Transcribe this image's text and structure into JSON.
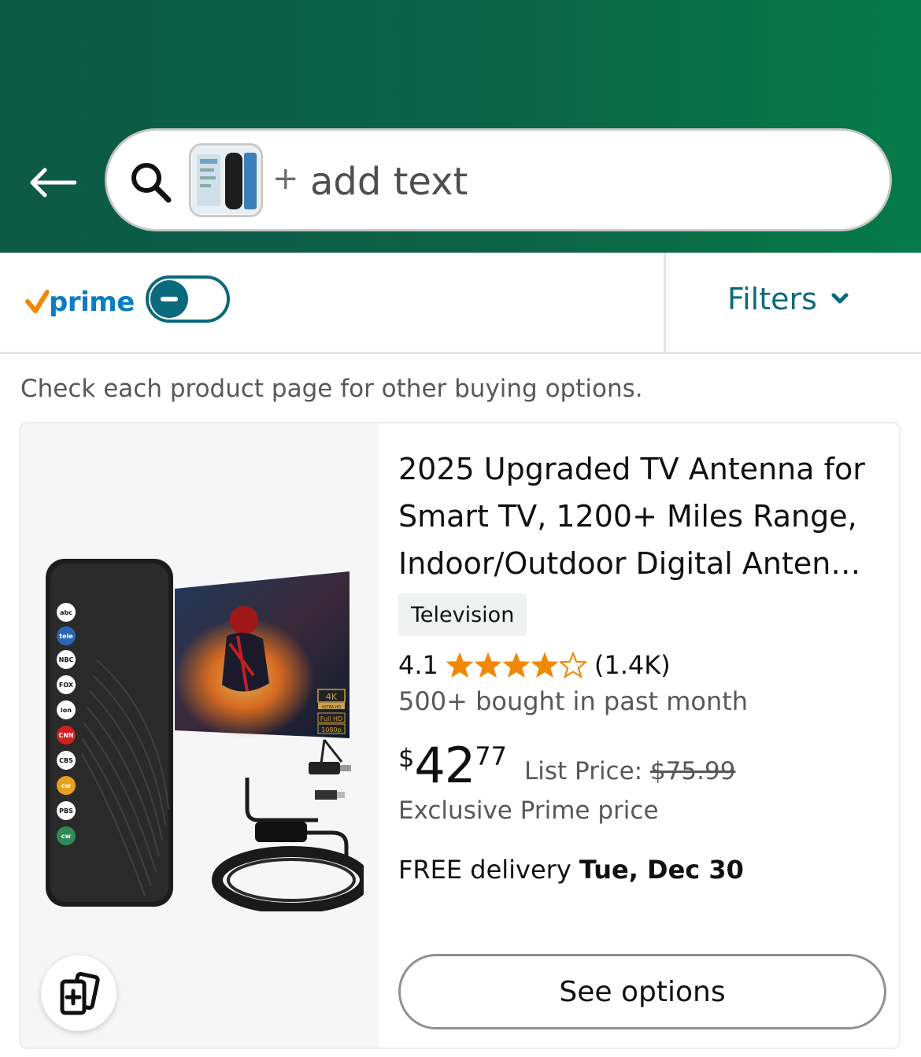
{
  "header": {
    "back_icon": "back-arrow-icon",
    "search": {
      "icon": "search-icon",
      "plus": "+",
      "placeholder": "add text",
      "thumbnail": "search-image-thumbnail"
    }
  },
  "filter_bar": {
    "prime_label": "prime",
    "prime_toggle_on": false,
    "filters_label": "Filters",
    "filters_icon": "chevron-down-icon"
  },
  "notice": "Check each product page for other buying options.",
  "product": {
    "title": "2025 Upgraded TV Antenna for Smart TV, 1200+ Miles Range, Indoor/Outdoor Digital Anten…",
    "badge": "Television",
    "rating": "4.1",
    "rating_value": 4.1,
    "review_count": "(1.4K)",
    "bought": "500+ bought in past month",
    "price": {
      "symbol": "$",
      "whole": "42",
      "fraction": "77"
    },
    "list_price_label": "List Price:",
    "list_price_value": "$75.99",
    "exclusive": "Exclusive Prime price",
    "delivery_prefix": "FREE delivery",
    "delivery_date": "Tue, Dec 30",
    "button_label": "See options",
    "image_badges": {
      "res1": "4K",
      "res1_sub": "ULTRA HD",
      "res2": "Full HD",
      "res3": "1080p",
      "channels": [
        "abc",
        "tele",
        "NBC",
        "FOX",
        "ion",
        "CNN",
        "CBS",
        "cw",
        "PBS",
        "cw"
      ]
    }
  },
  "colors": {
    "header_green": "#0b6346",
    "accent_teal": "#0a6a7c",
    "prime_blue": "#0a7dc2",
    "prime_check": "#f08804",
    "star": "#f08804"
  }
}
